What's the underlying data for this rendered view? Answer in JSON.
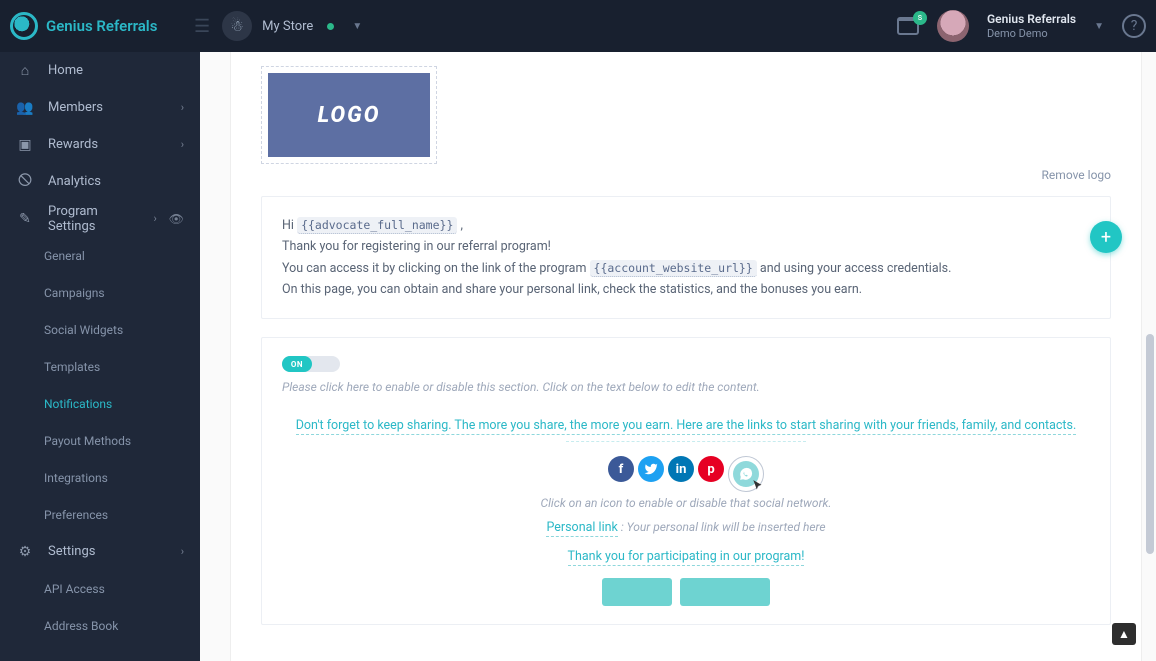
{
  "brand": "Genius Referrals",
  "store": {
    "label": "My Store"
  },
  "user": {
    "name": "Genius Referrals",
    "sub": "Demo Demo"
  },
  "mail_badge": "s",
  "sidebar": {
    "home": "Home",
    "members": "Members",
    "rewards": "Rewards",
    "analytics": "Analytics",
    "program": "Program Settings",
    "sub": {
      "general": "General",
      "campaigns": "Campaigns",
      "social": "Social Widgets",
      "templates": "Templates",
      "notifications": "Notifications",
      "payout": "Payout Methods",
      "integrations": "Integrations",
      "preferences": "Preferences"
    },
    "settings": "Settings",
    "api": "API Access",
    "address": "Address Book"
  },
  "content": {
    "logo_text": "LOGO",
    "remove_logo": "Remove logo",
    "body": {
      "l1a": "Hi ",
      "chip1": "{{advocate_full_name}}",
      "l1b": " ,",
      "l2": "Thank you for registering in our referral program!",
      "l3a": "You can access it by clicking on the link of the program ",
      "chip2": "{{account_website_url}}",
      "l3b": " and using your access credentials.",
      "l4": "On this page, you can obtain and share your personal link, check the statistics, and the bonuses you earn."
    },
    "toggle": "ON",
    "hint1": "Please click here to enable or disable this section. Click on the text below to edit the content.",
    "share_cta": "Don't forget to keep sharing. The more you share, the more you earn. Here are the links to start sharing with your friends, family, and contacts.",
    "hint2": "Click on an icon to enable or disable that social network.",
    "personal_link_label": "Personal link",
    "personal_link_desc": " : Your personal link will be inserted here",
    "thanks": "Thank you for participating in our program!"
  }
}
